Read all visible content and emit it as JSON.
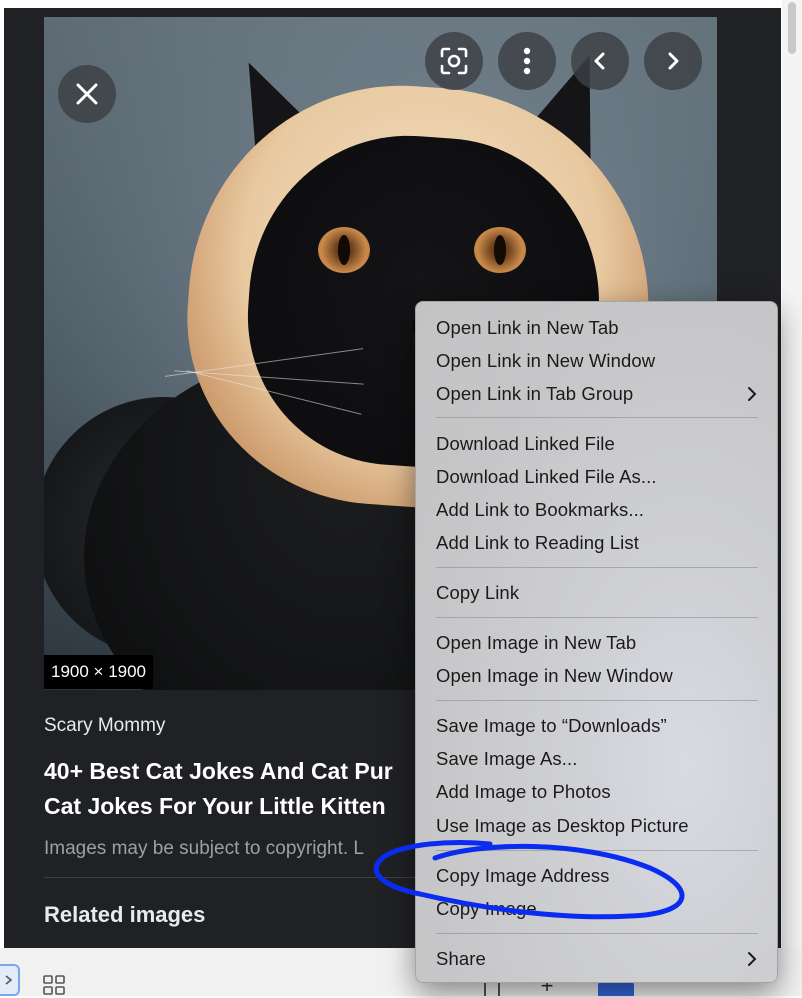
{
  "viewer": {
    "image_size": "1900 × 1900",
    "source": "Scary Mommy",
    "title_line1": "40+ Best Cat Jokes And Cat Pur",
    "title_line2": "Cat Jokes For Your Little Kitten",
    "notice": "Images may be subject to copyright. L",
    "related": "Related images",
    "buttons": {
      "close": "close-icon",
      "lens": "lens-icon",
      "more": "more-vert-icon",
      "prev": "chevron-left-icon",
      "next": "chevron-right-icon"
    }
  },
  "context_menu": {
    "groups": [
      [
        {
          "label": "Open Link in New Tab"
        },
        {
          "label": "Open Link in New Window"
        },
        {
          "label": "Open Link in Tab Group",
          "submenu": true
        }
      ],
      [
        {
          "label": "Download Linked File"
        },
        {
          "label": "Download Linked File As..."
        },
        {
          "label": "Add Link to Bookmarks..."
        },
        {
          "label": "Add Link to Reading List"
        }
      ],
      [
        {
          "label": "Copy Link"
        }
      ],
      [
        {
          "label": "Open Image in New Tab"
        },
        {
          "label": "Open Image in New Window"
        }
      ],
      [
        {
          "label": "Save Image to “Downloads”"
        },
        {
          "label": "Save Image As..."
        },
        {
          "label": "Add Image to Photos"
        },
        {
          "label": "Use Image as Desktop Picture"
        }
      ],
      [
        {
          "label": "Copy Image Address"
        },
        {
          "label": "Copy Image"
        }
      ],
      [
        {
          "label": "Share",
          "submenu": true
        }
      ]
    ]
  },
  "colors": {
    "panel_bg": "#202124",
    "highlight_annotation": "#0a2cf0"
  }
}
